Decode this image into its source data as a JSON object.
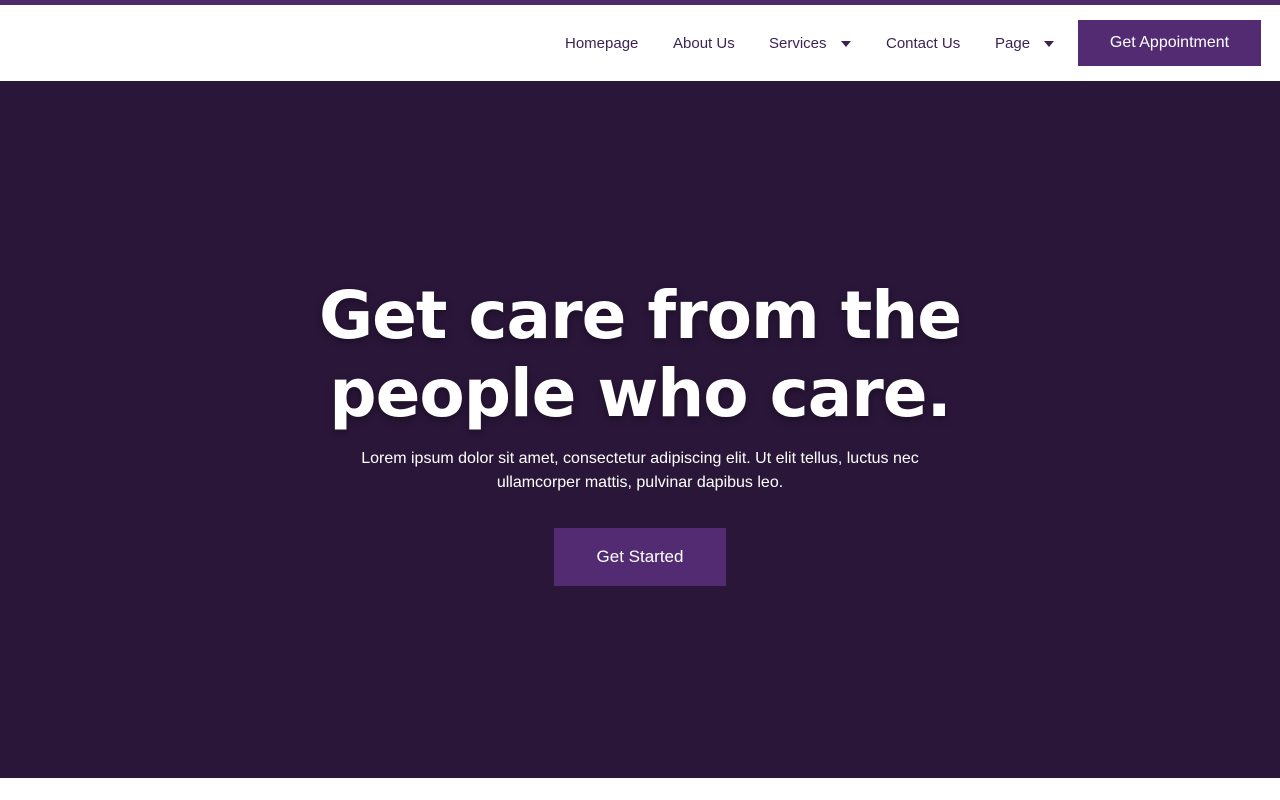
{
  "colors": {
    "brand_purple": "#532b72",
    "hero_background": "#2a1639",
    "nav_text": "#3c2352",
    "top_strip": "#4e2a6b"
  },
  "nav": {
    "items": [
      {
        "label": "Homepage",
        "has_dropdown": false
      },
      {
        "label": "About Us",
        "has_dropdown": false
      },
      {
        "label": "Services",
        "has_dropdown": true
      },
      {
        "label": "Contact Us",
        "has_dropdown": false
      },
      {
        "label": "Page",
        "has_dropdown": true
      }
    ],
    "cta_label": "Get Appointment"
  },
  "hero": {
    "title_line1": "Get care from the",
    "title_line2": "people who care.",
    "subtitle_line1": "Lorem ipsum dolor sit amet, consectetur adipiscing elit. Ut elit tellus, luctus nec",
    "subtitle_line2": "ullamcorper mattis, pulvinar dapibus leo.",
    "cta_label": "Get Started"
  },
  "icons": {
    "dropdown": "caret-down-icon"
  }
}
